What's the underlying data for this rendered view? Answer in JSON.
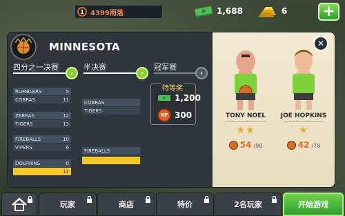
{
  "topbar": {
    "player_level": "1",
    "player_name": "4399雨落",
    "cash": "1,688",
    "gold": "6",
    "add_label": "+"
  },
  "team": {
    "name": "MINNESOTA"
  },
  "rounds": [
    {
      "label": "四分之一决赛"
    },
    {
      "label": "半决赛"
    },
    {
      "label": "冠军赛"
    }
  ],
  "quarterfinals": [
    {
      "top": {
        "name": "RUMBLERS",
        "score": "5"
      },
      "bottom": {
        "name": "COBRAS",
        "score": "11"
      }
    },
    {
      "top": {
        "name": "ZEBRAS",
        "score": "12"
      },
      "bottom": {
        "name": "TIGERS",
        "score": "13"
      }
    },
    {
      "top": {
        "name": "FIREBALLS",
        "score": "10"
      },
      "bottom": {
        "name": "VIPERS",
        "score": "6"
      }
    },
    {
      "top": {
        "name": "DOLPHINS",
        "score": "0"
      },
      "bottom": {
        "name": "",
        "score": "12"
      }
    }
  ],
  "semifinals": [
    {
      "top": "COBRAS",
      "bottom": "TIGERS"
    },
    {
      "top": "FIREBALLS",
      "bottom": ""
    }
  ],
  "prize": {
    "title": "特等奖",
    "cash": "1,200",
    "xp_label": "XP",
    "xp": "300"
  },
  "players": [
    {
      "name": "TONY NOEL",
      "stars": "★★",
      "stat": "54",
      "stat_max": "/90",
      "jersey": "#7fd13b"
    },
    {
      "name": "JOE HOPKINS",
      "stars": "★",
      "stat": "42",
      "stat_max": "/78",
      "jersey": "#7fd13b"
    }
  ],
  "close_label": "✕",
  "nav": {
    "player": "玩家",
    "shop": "商店",
    "deals": "特价",
    "two_player": "2名玩家",
    "start": "开始游戏"
  },
  "colors": {
    "accent_green": "#5cc23a",
    "highlight_yellow": "#f5c928",
    "stat_orange": "#e06f28"
  }
}
